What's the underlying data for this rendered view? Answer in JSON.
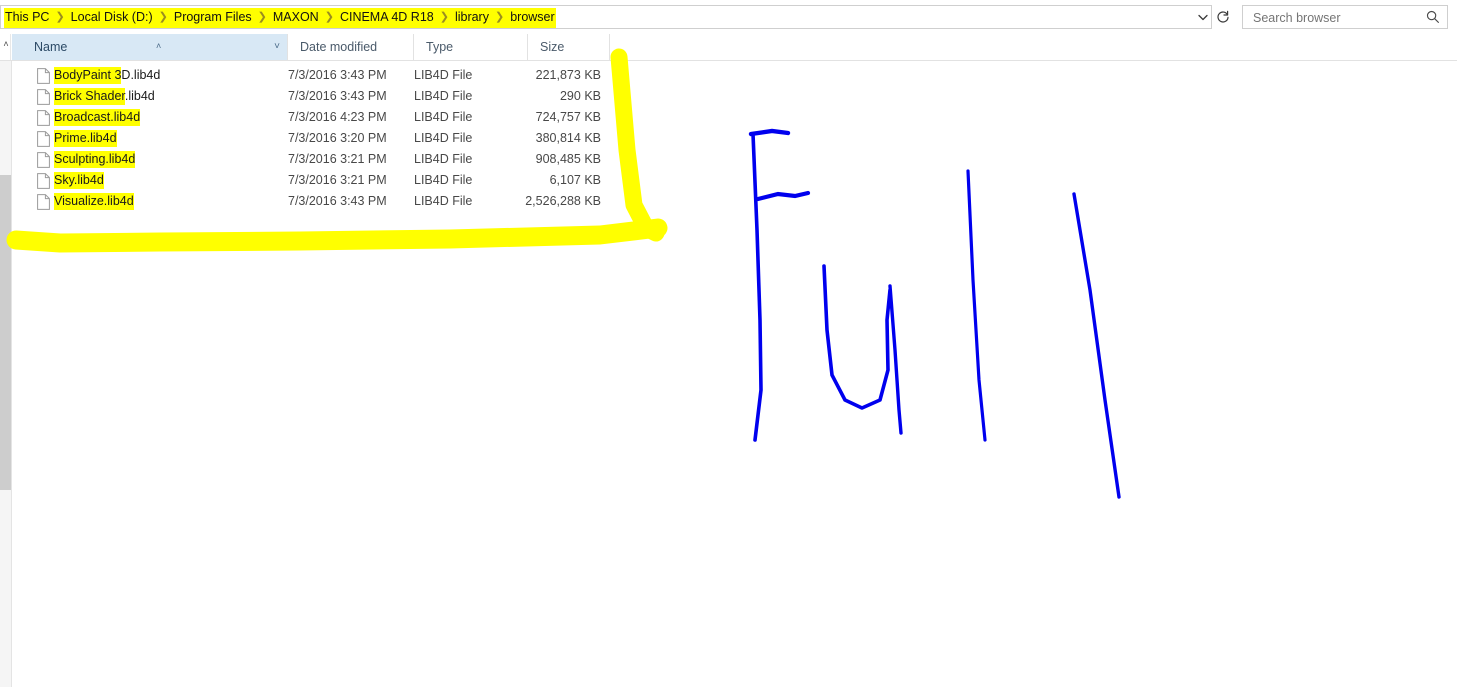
{
  "address": {
    "breadcrumb": [
      "This PC",
      "Local Disk (D:)",
      "Program Files",
      "MAXON",
      "CINEMA 4D R18",
      "library",
      "browser"
    ],
    "separator": "❯",
    "chevron_icon": "chevron-down",
    "refresh_icon": "refresh"
  },
  "search": {
    "placeholder": "Search browser",
    "value": "",
    "icon": "search-icon"
  },
  "columns": {
    "name": "Name",
    "date_modified": "Date modified",
    "type": "Type",
    "size": "Size",
    "sort_caret": "˄",
    "drop_caret": "˅",
    "collapse_caret": "˄"
  },
  "files": [
    {
      "name_highlighted": "BodyPaint 3",
      "name_rest": "D.lib4d",
      "date": "7/3/2016 3:43 PM",
      "type": "LIB4D File",
      "size": "221,873 KB"
    },
    {
      "name_highlighted": "Brick Shader",
      "name_rest": ".lib4d",
      "date": "7/3/2016 3:43 PM",
      "type": "LIB4D File",
      "size": "290 KB"
    },
    {
      "name_highlighted": "Broadcast.lib4d",
      "name_rest": "",
      "date": "7/3/2016 4:23 PM",
      "type": "LIB4D File",
      "size": "724,757 KB"
    },
    {
      "name_highlighted": "Prime.lib4d",
      "name_rest": "",
      "date": "7/3/2016 3:20 PM",
      "type": "LIB4D File",
      "size": "380,814 KB"
    },
    {
      "name_highlighted": "Sculpting.lib4d",
      "name_rest": "",
      "date": "7/3/2016 3:21 PM",
      "type": "LIB4D File",
      "size": "908,485 KB"
    },
    {
      "name_highlighted": "Sky.lib4d",
      "name_rest": "",
      "date": "7/3/2016 3:21 PM",
      "type": "LIB4D File",
      "size": "6,107 KB"
    },
    {
      "name_highlighted": "Visualize.lib4d",
      "name_rest": "",
      "date": "7/3/2016 3:43 PM",
      "type": "LIB4D File",
      "size": "2,526,288 KB"
    }
  ],
  "annotations": {
    "handwriting_text": "Full",
    "highlighter_color": "#ffff00",
    "ink_color": "#0000ee",
    "file_icon_name": "file-document-icon"
  }
}
